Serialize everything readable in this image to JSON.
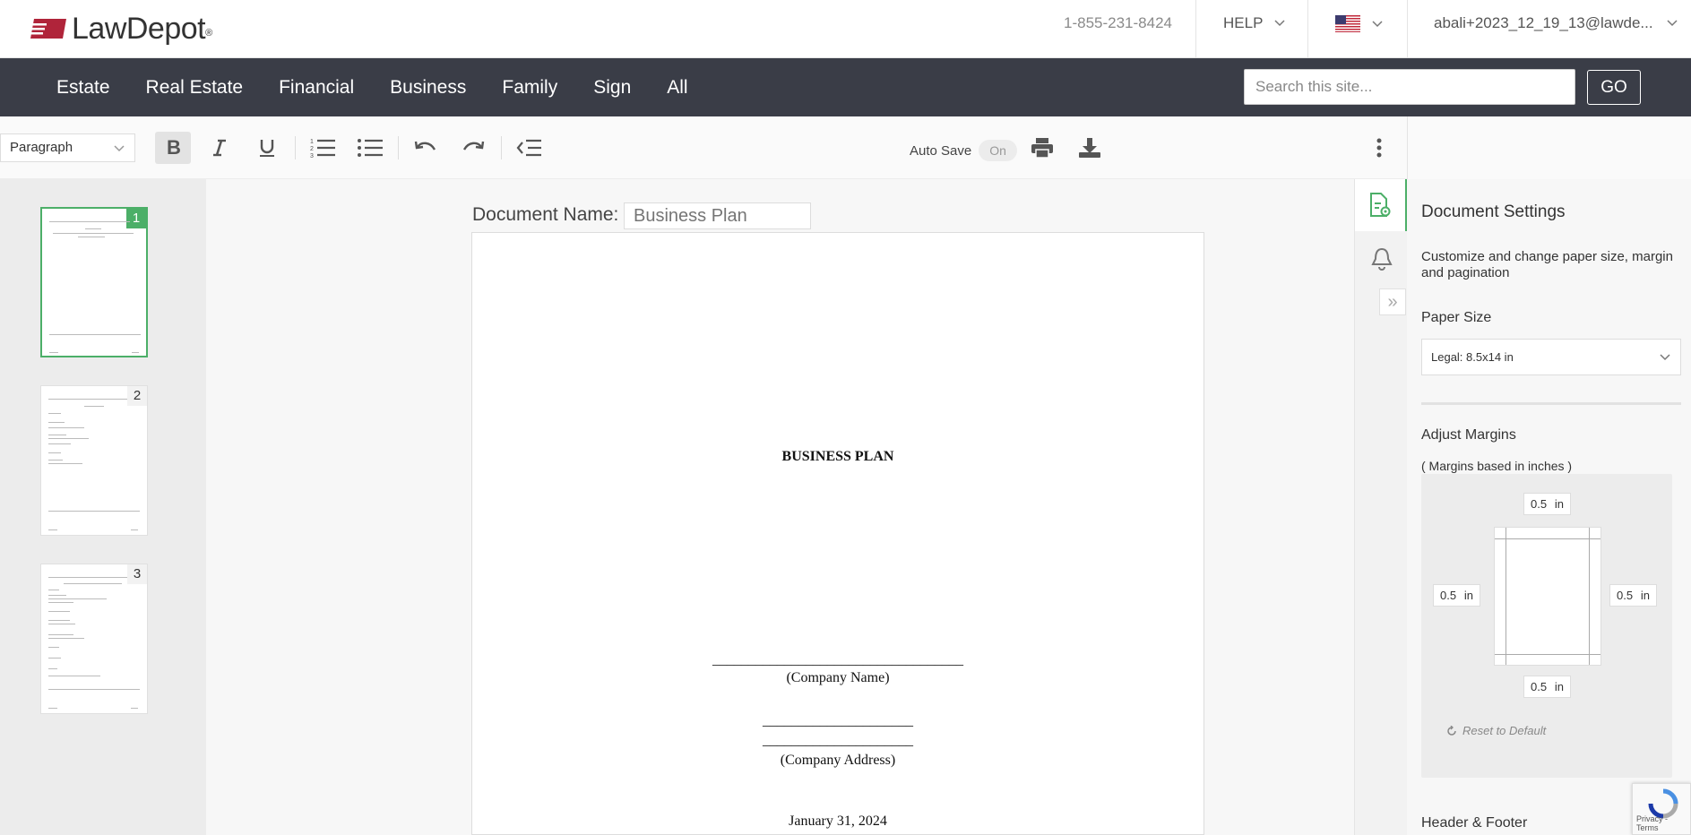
{
  "header": {
    "logo_text": "LawDepot",
    "logo_reg": "®",
    "phone": "1-855-231-8424",
    "help_label": "HELP",
    "user_email": "abali+2023_12_19_13@lawde..."
  },
  "nav": {
    "items": [
      "Estate",
      "Real Estate",
      "Financial",
      "Business",
      "Family",
      "Sign",
      "All"
    ],
    "search_placeholder": "Search this site...",
    "go_label": "GO"
  },
  "toolbar": {
    "paragraph_value": "Paragraph",
    "autosave_label": "Auto Save",
    "autosave_state": "On"
  },
  "thumbnails": {
    "pages": [
      "1",
      "2",
      "3"
    ],
    "selected": "1"
  },
  "document": {
    "name_label": "Document Name:",
    "name_placeholder": "Business Plan",
    "title": "BUSINESS PLAN",
    "company_line": "___________________________________",
    "company_name": "(Company Name)",
    "address_line_1": "_____________________",
    "address_line_2": "_____________________",
    "company_address": "(Company Address)",
    "date": "January 31, 2024"
  },
  "settings": {
    "title": "Document Settings",
    "description": "Customize and change paper size, margin and pagination",
    "paper_size_label": "Paper Size",
    "paper_size_value": "Legal: 8.5x14 in",
    "margins_label": "Adjust Margins",
    "margins_note": "( Margins based in inches )",
    "margin_top": "0.5",
    "margin_left": "0.5",
    "margin_right": "0.5",
    "margin_bottom": "0.5",
    "unit": "in",
    "reset_label": "Reset to Default",
    "header_footer_label": "Header & Footer"
  },
  "recaptcha": {
    "text": "Privacy - Terms"
  },
  "colors": {
    "brand_red": "#b0243a",
    "nav_bg": "#3a3d47",
    "accent_green": "#4caf68"
  }
}
